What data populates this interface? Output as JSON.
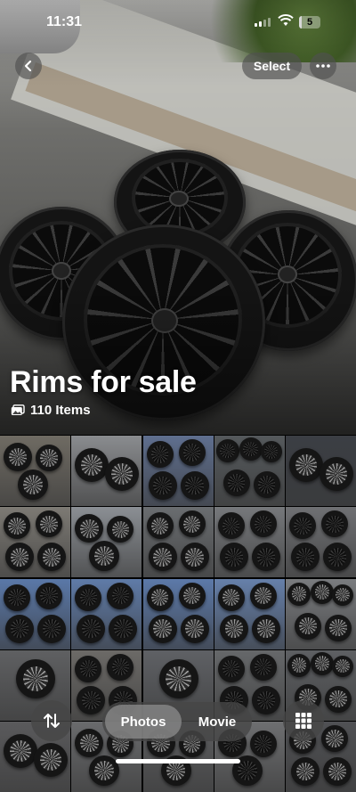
{
  "status_bar": {
    "time": "11:31",
    "battery_level": "5",
    "battery_fraction": 0.05
  },
  "header": {
    "back_icon": "chevron-left-icon",
    "select_label": "Select",
    "more_icon": "ellipsis-icon"
  },
  "album": {
    "title": "Rims for sale",
    "count_label": "110 Items",
    "count_icon": "photo-stack-icon"
  },
  "grid": {
    "columns": 5,
    "thumbnails": [
      {
        "bg": "#6f6b63",
        "tone": "light",
        "wheels": 3
      },
      {
        "bg": "#8a8c8f",
        "tone": "light",
        "wheels": 2
      },
      {
        "bg": "#5f6f8f",
        "tone": "dark",
        "wheels": 4
      },
      {
        "bg": "#55595c",
        "tone": "dark",
        "wheels": 5
      },
      {
        "bg": "#3b3e44",
        "tone": "light",
        "wheels": 2
      },
      {
        "bg": "#7d7a74",
        "tone": "light",
        "wheels": 4
      },
      {
        "bg": "#8b8f94",
        "tone": "light",
        "wheels": 3
      },
      {
        "bg": "#6a6d70",
        "tone": "light",
        "wheels": 4
      },
      {
        "bg": "#76787b",
        "tone": "dark",
        "wheels": 4
      },
      {
        "bg": "#6f7073",
        "tone": "dark",
        "wheels": 4
      },
      {
        "bg": "#5a78a8",
        "tone": "dark",
        "wheels": 4
      },
      {
        "bg": "#5f7ba8",
        "tone": "dark",
        "wheels": 4
      },
      {
        "bg": "#5c79a9",
        "tone": "light",
        "wheels": 4
      },
      {
        "bg": "#6680aa",
        "tone": "light",
        "wheels": 4
      },
      {
        "bg": "#7a7c7f",
        "tone": "light",
        "wheels": 5
      },
      {
        "bg": "#5f6062",
        "tone": "light",
        "wheels": 1
      },
      {
        "bg": "#6c6a67",
        "tone": "dark",
        "wheels": 4
      },
      {
        "bg": "#5f6165",
        "tone": "light",
        "wheels": 1
      },
      {
        "bg": "#66686a",
        "tone": "dark",
        "wheels": 4
      },
      {
        "bg": "#5e6063",
        "tone": "light",
        "wheels": 5
      },
      {
        "bg": "#5a5a5c",
        "tone": "light",
        "wheels": 2
      },
      {
        "bg": "#6a6b6d",
        "tone": "light",
        "wheels": 3
      },
      {
        "bg": "#5d5e60",
        "tone": "light",
        "wheels": 3
      },
      {
        "bg": "#6e6f71",
        "tone": "dark",
        "wheels": 3
      },
      {
        "bg": "#505154",
        "tone": "light",
        "wheels": 4
      }
    ]
  },
  "bottom_bar": {
    "sort_icon": "sort-arrows-icon",
    "segment": {
      "photos_label": "Photos",
      "movie_label": "Movie",
      "selected": "Photos"
    },
    "grid_icon": "grid-icon"
  }
}
